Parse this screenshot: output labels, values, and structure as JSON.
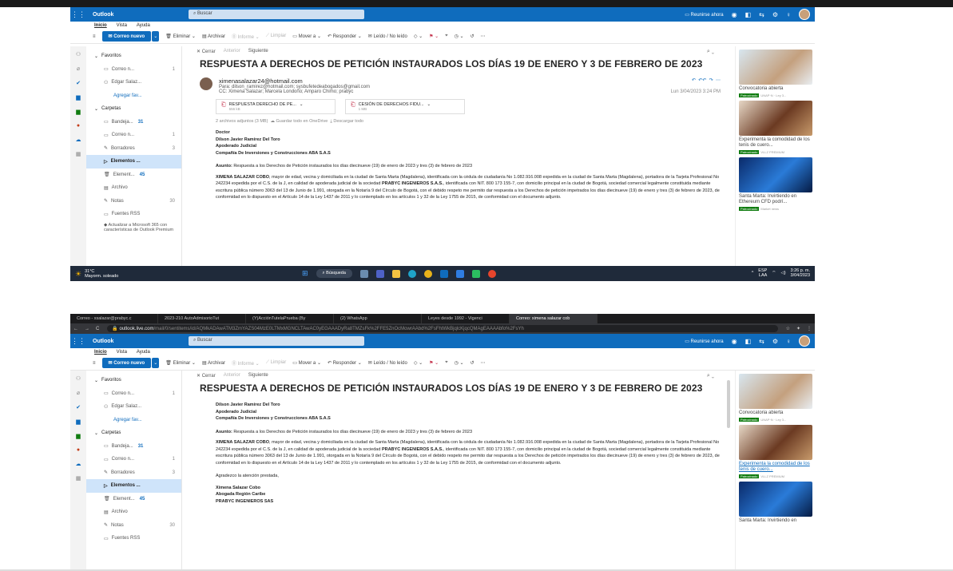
{
  "outlook": {
    "app_name": "Outlook",
    "search_placeholder": "Buscar",
    "meet_now": "Reunirse ahora",
    "menu": [
      "Inicio",
      "Vista",
      "Ayuda"
    ],
    "ribbon": {
      "new_mail": "Correo nuevo",
      "delete": "Eliminar",
      "archive": "Archivar",
      "report": "Informe",
      "sweep": "Limpiar",
      "move_to": "Mover a",
      "reply": "Responder",
      "read_unread": "Leído / No leído"
    },
    "folders": {
      "favorites": "Favoritos",
      "fav_items": [
        {
          "label": "Correo n...",
          "count": "1"
        },
        {
          "label": "Edgar Salaz..."
        }
      ],
      "add_favorite": "Agregar fav...",
      "folders_header": "Carpetas",
      "items": [
        {
          "label": "Bandeja...",
          "count": "31"
        },
        {
          "label": "Correo n...",
          "count": "1"
        },
        {
          "label": "Borradores",
          "count": "3"
        },
        {
          "label": "Elementos ..."
        },
        {
          "label": "Element...",
          "count": "45"
        },
        {
          "label": "Archivo"
        },
        {
          "label": "Notas",
          "count": "30"
        },
        {
          "label": "Fuentes RSS"
        }
      ],
      "promo": "Actualizar a Microsoft 365 con características de Outlook Premium"
    },
    "reading": {
      "close": "Cerrar",
      "previous": "Anterior",
      "next": "Siguiente",
      "subject": "RESPUESTA A DERECHOS DE PETICIÓN INSTAURADOS LOS DÍAS 19 DE ENERO Y 3 DE FEBRERO DE 2023",
      "from": "ximenasalazar24@hotmail.com",
      "to": "Para: dilson_ramirez@hotmail.com; sysbufetedeabogados@gmail.com",
      "cc": "CC: Ximena Salazar; Marcela Londoño; Amparo Chimo; prabyc",
      "date": "Lun 3/04/2023 3:24 PM",
      "attachments": [
        {
          "name": "RESPUESTA DERECHO DE PE...",
          "size": "556 kB"
        },
        {
          "name": "CESIÓN DE DERECHOS FIDU...",
          "size": "1 MB"
        }
      ],
      "attach_info": "2 archivos adjuntos (3 MB)",
      "save_onedrive": "Guardar todo en OneDrive",
      "download_all": "Descargar todo",
      "addressee_title": "Doctor",
      "addressee_name": "Dilson Javier Ramírez Del Toro",
      "addressee_role": "Apoderado Judicial",
      "addressee_company": "Compañía De Inversiones y Construcciones ABA S.A.S",
      "asunto_label": "Asunto:",
      "asunto_text": "Respuesta a los Derechos de Petición instaurados los días diecinueve (19) de enero de 2023 y tres (3) de febrero de 2023",
      "para1_name": "XIMENA SALAZAR COBO",
      "para1_a": ", mayor de edad, vecina y domiciliada en la ciudad de Santa Marta (Magdalena), identificada con la cédula de ciudadanía No 1.082.916.008 expedida en la ciudad de Santa Marta (Magdalena), portadora de la Tarjeta Profesional No 242234 expedida por el C.S. de la J, en calidad de apoderada judicial de la sociedad ",
      "para1_company": "PRABYC INGENIEROS S.A.S.",
      "para1_b": ", identificada con NIT. 800 173 155-7, con domicilio principal en la ciudad de Bogotá, sociedad comercial legalmente constituida mediante escritura pública número 3063 del 13 de Junio de 1.991, otorgada en la Notaría 9 del Círculo de Bogotá, con el debido respeto me permito dar respuesta a los Derechos de petición impetrados los días diecinueve (19) de enero y tres (3) de febrero de 2023, de conformidad en lo dispuesto en el Artículo 14 de la Ley 1437 de 2011 y lo contemplado en los artículos 1 y 32 de la Ley 1755 de 2015, de conformidad con el documento adjunto.",
      "thanks": "Agradezco la atención prestada,",
      "sig_name": "Ximena Salazar Cobo",
      "sig_role": "Abogada Región Caribe",
      "sig_company": "PRABYC INGENIEROS SAS"
    },
    "ads": {
      "ad1": "Convocatoria abierta",
      "ad2": "Experimenta la comodidad de los tenis de cuero...",
      "ad3": "Santa Marta: Invirtiendo en Ethereum CFD podrí...",
      "ad3_short": "Santa Marta: Invirtiendo en",
      "sponsored": "Patrocinado",
      "ad1_src": "UNAP·N · Ley 3...",
      "ad2_src": "VLLZ PREMIUM",
      "ad3_src": "Market news"
    }
  },
  "taskbar": {
    "temp": "31°C",
    "weather": "Mayorm. soleado",
    "search": "Búsqueda",
    "lang1": "ESP",
    "lang2": "LAA",
    "time": "3:26 p. m.",
    "date": "3/04/2023"
  },
  "browser": {
    "tabs": [
      "Correo - xsalazar@prabyc.c",
      "2023-210 AutoAdmisorioTut",
      "(Y)AcciónTutelaPrueba (By",
      "(2) WhatsApp",
      "Leyes desde 1992 - Vigenci",
      "Correo: ximena salazar cob"
    ],
    "url_host": "outlook.live.com",
    "url_path": "/mail/0/sentitems/id/AQMkADAwATM3ZmYAZS04MzE0LTMxMGNCLTAwAC0yEGAAADyRa8TMZsFk%2FFE5ZnOcMowrAAbd%2FsFhtWkBjqlcKjqcQMAgEAAAAbfo%2FsYh",
    "back": "←",
    "forward": "→",
    "reload": "C"
  }
}
